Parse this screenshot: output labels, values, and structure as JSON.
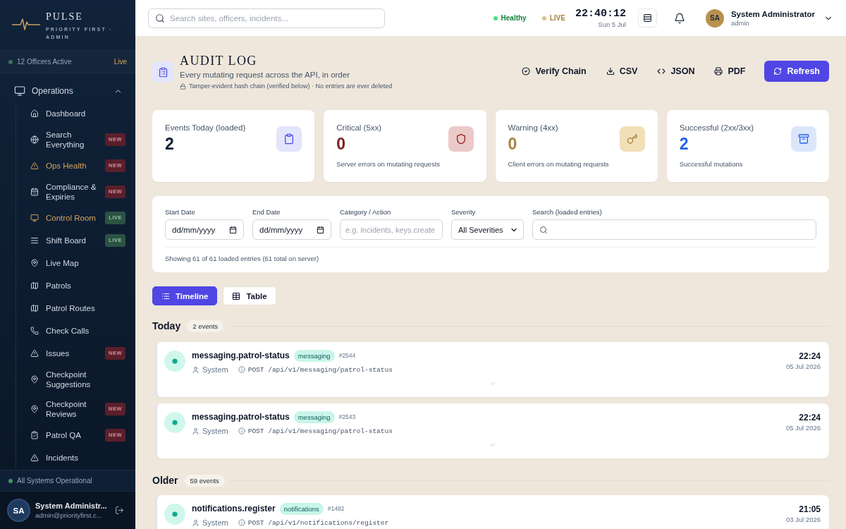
{
  "sidebar": {
    "brand": {
      "name": "PULSE",
      "tagline": "PRIORITY FIRST · ADMIN"
    },
    "presence": {
      "label": "12 Officers Active",
      "status": "Live"
    },
    "groups": [
      {
        "label": "Operations",
        "expanded": true,
        "items": [
          {
            "label": "Dashboard",
            "highlighted": false
          },
          {
            "label": "Search Everything",
            "highlighted": false,
            "badge": {
              "text": "NEW",
              "kind": "new"
            }
          },
          {
            "label": "Ops Health",
            "highlighted": true,
            "badge": {
              "text": "NEW",
              "kind": "new"
            }
          },
          {
            "label": "Compliance & Expiries",
            "highlighted": false,
            "badge": {
              "text": "NEW",
              "kind": "new"
            }
          },
          {
            "label": "Control Room",
            "highlighted": true,
            "badge": {
              "text": "LIVE",
              "kind": "live"
            }
          },
          {
            "label": "Shift Board",
            "highlighted": false,
            "badge": {
              "text": "LIVE",
              "kind": "live"
            }
          },
          {
            "label": "Live Map",
            "highlighted": false
          },
          {
            "label": "Patrols",
            "highlighted": false
          },
          {
            "label": "Patrol Routes",
            "highlighted": false
          },
          {
            "label": "Check Calls",
            "highlighted": false
          },
          {
            "label": "Issues",
            "highlighted": false,
            "badge": {
              "text": "NEW",
              "kind": "new"
            }
          },
          {
            "label": "Checkpoint Suggestions",
            "highlighted": false
          },
          {
            "label": "Checkpoint Reviews",
            "highlighted": false,
            "badge": {
              "text": "NEW",
              "kind": "new"
            }
          },
          {
            "label": "Patrol QA",
            "highlighted": false,
            "badge": {
              "text": "NEW",
              "kind": "new"
            }
          },
          {
            "label": "Incidents",
            "highlighted": false
          }
        ]
      }
    ],
    "system_status": "All Systems Operational",
    "user": {
      "initials": "SA",
      "name": "System Administr...",
      "email": "admin@priorityfirst.c..."
    }
  },
  "header": {
    "search": {
      "placeholder": "Search sites, officers, incidents..."
    },
    "statuses": [
      {
        "label": "Healthy",
        "kind": "healthy"
      },
      {
        "label": "LIVE",
        "kind": "live"
      }
    ],
    "clock": {
      "time": "22:40:12",
      "date": "Sun 5 Jul"
    },
    "user": {
      "initials": "SA",
      "name": "System Administrator",
      "role": "admin"
    }
  },
  "page": {
    "title": "AUDIT LOG",
    "subtitle": "Every mutating request across the API, in order",
    "note": "Tamper-evident hash chain (verified below) · No entries are ever deleted",
    "actions": [
      {
        "label": "Verify Chain",
        "primary": false
      },
      {
        "label": "CSV",
        "primary": false
      },
      {
        "label": "JSON",
        "primary": false
      },
      {
        "label": "PDF",
        "primary": false
      },
      {
        "label": "Refresh",
        "primary": true
      }
    ]
  },
  "stats": [
    {
      "label": "Events Today (loaded)",
      "value": "2",
      "kind": "neutral"
    },
    {
      "label": "Critical (5xx)",
      "value": "0",
      "caption": "Server errors on mutating requests",
      "kind": "critical"
    },
    {
      "label": "Warning (4xx)",
      "value": "0",
      "caption": "Client errors on mutating requests",
      "kind": "warning"
    },
    {
      "label": "Successful (2xx/3xx)",
      "value": "2",
      "caption": "Successful mutations",
      "kind": "success"
    }
  ],
  "filters": {
    "fields": [
      {
        "label": "Start Date",
        "kind": "date",
        "placeholder": "dd/mm/yyyy"
      },
      {
        "label": "End Date",
        "kind": "date",
        "placeholder": "dd/mm/yyyy"
      },
      {
        "label": "Category / Action",
        "kind": "text",
        "placeholder": "e.g. incidents, keys.create"
      },
      {
        "label": "Severity",
        "kind": "select",
        "value": "All Severities"
      },
      {
        "label": "Search (loaded entries)",
        "kind": "search"
      }
    ],
    "summary": "Showing 61 of 61 loaded entries (61 total on server)"
  },
  "views": [
    {
      "label": "Timeline",
      "kind": "timeline",
      "selected": true
    },
    {
      "label": "Table",
      "kind": "table",
      "selected": false
    }
  ],
  "groups": [
    {
      "title": "Today",
      "count": "2 events",
      "events": [
        {
          "action": "messaging.patrol-status",
          "category": "messaging",
          "number": "#2544",
          "actor": "System",
          "request": "POST /api/v1/messaging/patrol-status",
          "time": "22:24",
          "date": "05 Jul 2026",
          "expanded": false
        },
        {
          "action": "messaging.patrol-status",
          "category": "messaging",
          "number": "#2543",
          "actor": "System",
          "request": "POST /api/v1/messaging/patrol-status",
          "time": "22:24",
          "date": "05 Jul 2026",
          "expanded": false
        }
      ]
    },
    {
      "title": "Older",
      "count": "59 events",
      "events": [
        {
          "action": "notifications.register",
          "category": "notifications",
          "number": "#1482",
          "actor": "System",
          "request": "POST /api/v1/notifications/register",
          "time": "21:05",
          "date": "03 Jul 2026"
        }
      ]
    }
  ]
}
